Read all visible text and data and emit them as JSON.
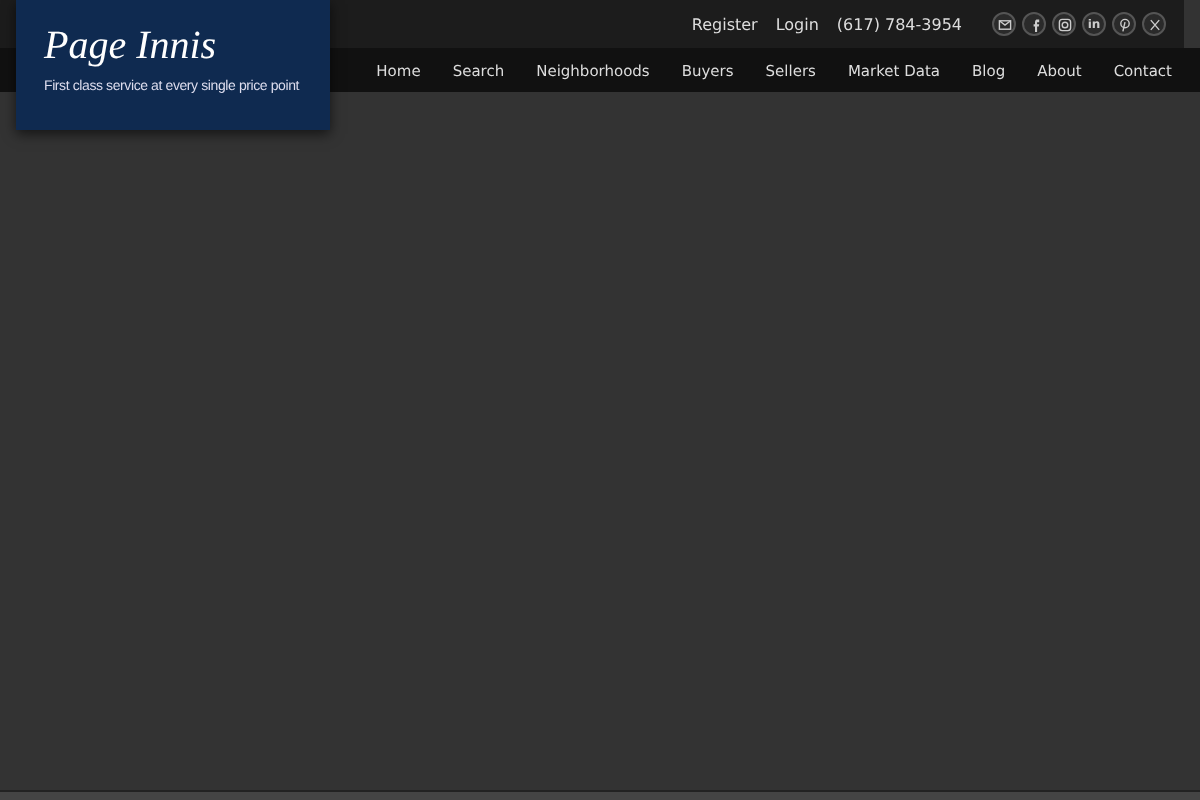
{
  "logo": {
    "title": "Page Innis",
    "tagline": "First class service at every single price point"
  },
  "top_links": [
    "Register",
    "Login",
    "(617) 784-3954"
  ],
  "social": [
    {
      "kind": "email"
    },
    {
      "kind": "facebook"
    },
    {
      "kind": "instagram"
    },
    {
      "kind": "linkedin",
      "label": "in"
    },
    {
      "kind": "pinterest"
    },
    {
      "kind": "x"
    }
  ],
  "nav": [
    "Home",
    "Search",
    "Neighborhoods",
    "Buyers",
    "Sellers",
    "Market Data",
    "Blog",
    "About",
    "Contact"
  ]
}
